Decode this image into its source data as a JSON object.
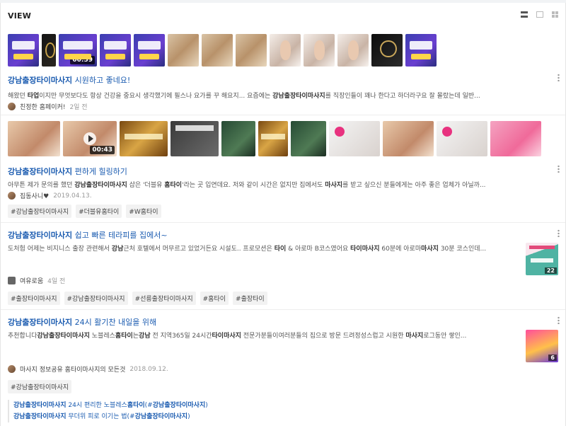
{
  "header": {
    "title": "VIEW"
  },
  "view_icons": [
    "list-view-icon",
    "image-list-view-icon",
    "grid-view-icon"
  ],
  "posts": [
    {
      "title_bold": "강남출장타이마사지",
      "title_rest": " 시원하고 좋네요!",
      "desc_html": "해왔던 <b>타업</b>이지만 무엇보다도 항상 건강을 중요시 생각했기에 필스나 요가를 꾸 해요지... 요즘에는 <b>강남출장타이마사지</b>를 직장인들이 꽤나 한다고 하더라구요 잘 몰랐는데 일반...",
      "author": "친정한 홈페이커!",
      "date": "2일 전",
      "tags": [],
      "video_duration": "00:59"
    },
    {
      "title_bold": "강남출장타이마사지",
      "title_rest": " 편하게 힐링하기",
      "desc_html": "아무튼 제가 문의를 했던 <b>강남출장타이마사지</b> 샵은 '더블유 <b>홈타이</b>'라는 곳 입연데요. 저와 같이 시간은 없지만 집에서도 <b>마사지</b>를 받고 싶으신 분들에게는 아주 좋은 업체가 아닐까...",
      "author": "집동사니♥",
      "date": "2019.04.13.",
      "tags": [
        "#강남출장타이마사지",
        "#더블유홈타이",
        "#W홈타이"
      ],
      "video_duration": "00:43"
    },
    {
      "title_bold": "강남출장타이마사지",
      "title_rest": " 쉽고 빠른 테라피를 집에서~",
      "desc_html": "도처험 어제는 비지니스 출장 관련해서 <b>강남</b>근처 호텔에서 머무르고 있었거든요 시설도.. 프로모션은 <b>타이</b> & 아로마 B코스였어요 <b>타이마사지</b> 60분에 아로마<b>마사지</b> 30분 코스인데...",
      "author": "여유로움",
      "date": "4일 전",
      "tags": [
        "#출장타이마사지",
        "#강남출장타이마사지",
        "#선릉출장타이마사지",
        "#홈타이",
        "#출장타이"
      ],
      "image_count": "22"
    },
    {
      "title_bold": "강남출장타이마사지",
      "title_rest": " 24시 활기찬 내일을 위해",
      "desc_html": "추천합니다<b>강남출장타이마사지</b> 노블레스<b>홈타이</b>는<b>강남</b> 전 지역365일 24시간<b>타이마사지</b> 전문가분들이여러분들의 집으로 방문 드려정성스럽고 시원한 <b>마사지</b>로그동안 쌓인...",
      "author": "마사지 정보공유 홈타이마사지의 모든것",
      "date": "2018.09.12.",
      "tags": [
        "#강남출장타이마사지"
      ],
      "image_count": "6"
    }
  ],
  "related": [
    {
      "bold": "강남출장타이마사지",
      "rest": " 24시 편리한 노블레스<b>홈타이</b>(#<b>강남출장타이마사지</b>)"
    },
    {
      "bold": "강남출장타이마사지",
      "rest": " 무더위 피로 이기는 법(#<b>강남출장타이마사지</b>)"
    }
  ]
}
